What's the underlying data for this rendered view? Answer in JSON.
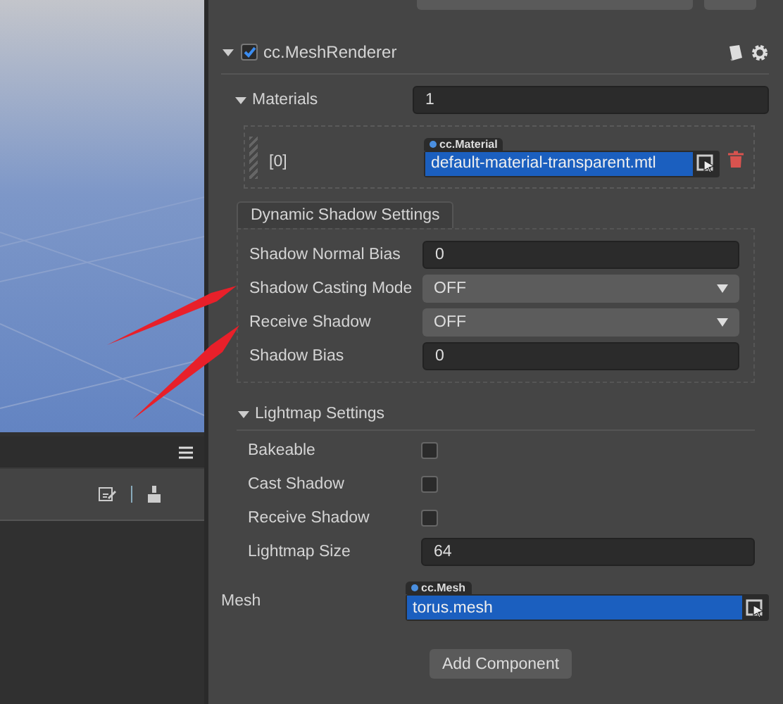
{
  "component": {
    "title": "cc.MeshRenderer",
    "enabled": true,
    "expanded": true
  },
  "materials": {
    "label": "Materials",
    "expanded": true,
    "count": "1",
    "items": [
      {
        "index": "[0]",
        "type": "cc.Material",
        "value": "default-material-transparent.mtl"
      }
    ]
  },
  "groups": [
    {
      "kind": "tab",
      "title": "Dynamic Shadow Settings",
      "expanded": true,
      "rows": [
        {
          "kind": "input",
          "label": "Shadow Normal Bias",
          "value": "0"
        },
        {
          "kind": "select",
          "label": "Shadow Casting Mode",
          "value": "OFF"
        },
        {
          "kind": "select",
          "label": "Receive Shadow",
          "value": "OFF"
        },
        {
          "kind": "input",
          "label": "Shadow Bias",
          "value": "0"
        }
      ]
    },
    {
      "kind": "fold",
      "title": "Lightmap Settings",
      "expanded": true,
      "rows": [
        {
          "kind": "checkbox",
          "label": "Bakeable",
          "checked": false
        },
        {
          "kind": "checkbox",
          "label": "Cast Shadow",
          "checked": false
        },
        {
          "kind": "checkbox",
          "label": "Receive Shadow",
          "checked": false
        },
        {
          "kind": "input",
          "label": "Lightmap Size",
          "value": "64"
        }
      ]
    }
  ],
  "mesh": {
    "label": "Mesh",
    "type": "cc.Mesh",
    "value": "torus.mesh"
  },
  "add_button": "Add Component"
}
